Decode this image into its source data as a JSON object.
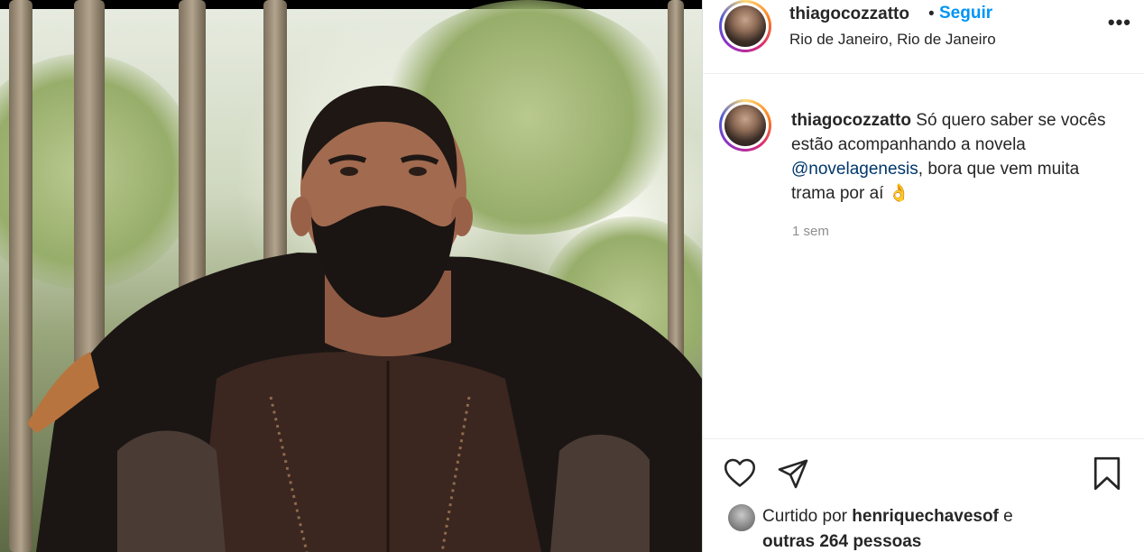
{
  "post": {
    "author": {
      "username": "thiagocozzatto",
      "location": "Rio de Janeiro, Rio de Janeiro"
    },
    "follow_separator": "•",
    "follow_label": "Seguir",
    "more_label": "•••",
    "caption": {
      "username": "thiagocozzatto",
      "text_before_mention": "Só quero saber se vocês estão acompanhando a novela",
      "mention": "@novelagenesis",
      "text_after_mention": ", bora que vem muita trama por aí",
      "emoji": "👌"
    },
    "timestamp": "1 sem",
    "likes": {
      "prefix": "Curtido por",
      "liker": "henriquechavesof",
      "conjunction": "e",
      "others": "outras 264 pessoas"
    }
  },
  "icons": {
    "like": "heart-icon",
    "share": "paper-plane-icon",
    "save": "bookmark-icon",
    "more": "more-options-icon"
  },
  "colors": {
    "link_blue": "#0095f6",
    "mention": "#00376b",
    "secondary_text": "#8e8e8e",
    "text": "#262626"
  }
}
